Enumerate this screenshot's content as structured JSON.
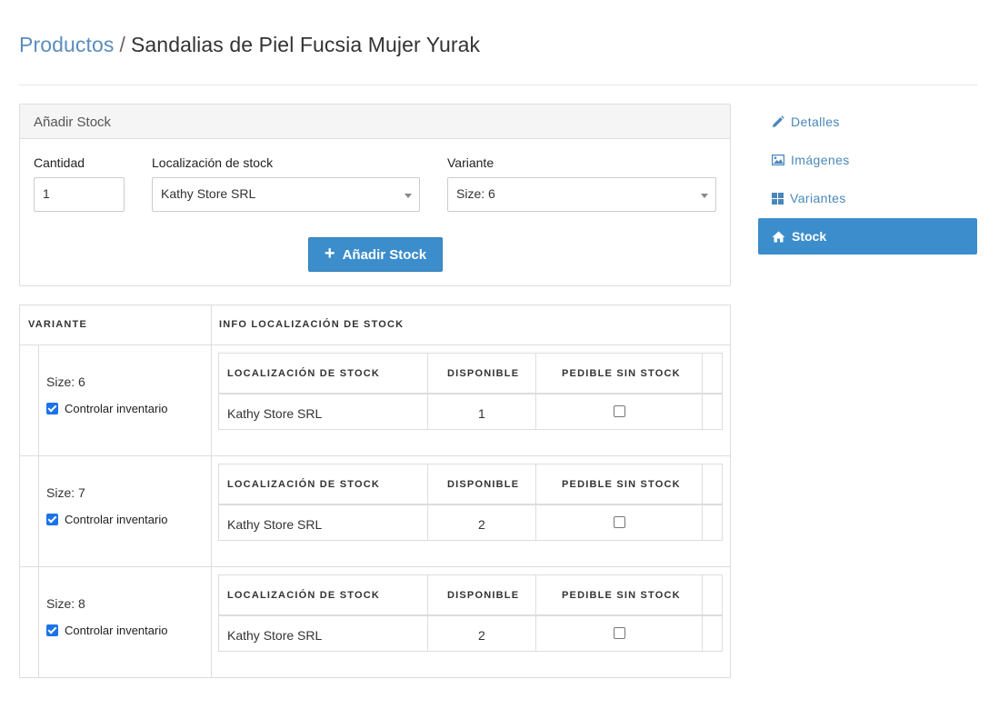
{
  "breadcrumb": {
    "parent": "Productos",
    "separator": "/",
    "current": "Sandalias de Piel Fucsia Mujer Yurak"
  },
  "add_stock": {
    "heading": "Añadir Stock",
    "quantity_label": "Cantidad",
    "quantity_value": "1",
    "location_label": "Localización de stock",
    "location_value": "Kathy Store SRL",
    "variant_label": "Variante",
    "variant_value": "Size: 6",
    "button_label": "Añadir Stock"
  },
  "stock_table": {
    "headers": {
      "variant": "VARIANTE",
      "info": "INFO LOCALIZACIÓN DE STOCK"
    },
    "inner_headers": {
      "location": "LOCALIZACIÓN DE STOCK",
      "available": "DISPONIBLE",
      "backorder": "PEDIBLE SIN STOCK"
    },
    "control_label": "Controlar inventario",
    "rows": [
      {
        "variant": "Size: 6",
        "track_inventory": true,
        "location": "Kathy Store SRL",
        "available": "1",
        "backorderable": false
      },
      {
        "variant": "Size: 7",
        "track_inventory": true,
        "location": "Kathy Store SRL",
        "available": "2",
        "backorderable": false
      },
      {
        "variant": "Size: 8",
        "track_inventory": true,
        "location": "Kathy Store SRL",
        "available": "2",
        "backorderable": false
      }
    ]
  },
  "side_nav": {
    "items": [
      {
        "label": "Detalles",
        "icon": "pencil-icon",
        "active": false
      },
      {
        "label": "Imágenes",
        "icon": "image-icon",
        "active": false
      },
      {
        "label": "Variantes",
        "icon": "grid-icon",
        "active": false
      },
      {
        "label": "Stock",
        "icon": "home-icon",
        "active": true
      }
    ]
  },
  "colors": {
    "accent": "#3c8dcb",
    "link": "#5a8dbd",
    "border": "#dddddd",
    "checkbox": "#1a73e8"
  }
}
